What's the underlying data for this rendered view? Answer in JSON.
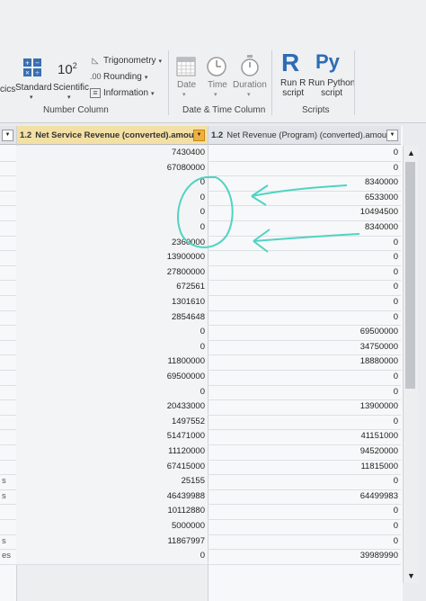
{
  "ribbon": {
    "cut_text": "cics",
    "standard": "Standard",
    "scientific": "Scientific",
    "scientific_base": "10",
    "scientific_exp": "2",
    "trigonometry": "Trigonometry",
    "rounding": "Rounding",
    "information": "Information",
    "date": "Date",
    "time": "Time",
    "duration": "Duration",
    "run_r_line1": "Run R",
    "run_r_line2": "script",
    "run_py_line1": "Run Python",
    "run_py_line2": "script",
    "r_logo": "R",
    "py_logo": "Py",
    "group_number_column": "Number Column",
    "group_date_time_column": "Date & Time Column",
    "group_scripts": "Scripts"
  },
  "grid": {
    "col1_type": "1.2",
    "col1_name": "Net Service Revenue (converted).amount",
    "col2_type": "1.2",
    "col2_name": "Net Revenue (Program) (converted).amount",
    "left_cells": [
      "",
      "",
      "",
      "",
      "",
      "",
      "",
      "",
      "",
      "",
      "",
      "",
      "",
      "",
      "",
      "",
      "",
      "",
      "",
      "",
      "",
      "",
      "s",
      "s",
      "",
      "",
      "s",
      "es"
    ],
    "col1": [
      "7430400",
      "67080000",
      "0",
      "0",
      "0",
      "0",
      "2360000",
      "13900000",
      "27800000",
      "672561",
      "1301610",
      "2854648",
      "0",
      "0",
      "11800000",
      "69500000",
      "0",
      "20433000",
      "1497552",
      "51471000",
      "11120000",
      "67415000",
      "25155",
      "46439988",
      "10112880",
      "5000000",
      "11867997",
      "0"
    ],
    "col2": [
      "0",
      "0",
      "8340000",
      "6533000",
      "10494500",
      "8340000",
      "0",
      "0",
      "0",
      "0",
      "0",
      "0",
      "69500000",
      "34750000",
      "18880000",
      "0",
      "0",
      "13900000",
      "0",
      "41151000",
      "94520000",
      "11815000",
      "0",
      "64499983",
      "0",
      "0",
      "0",
      "39989990"
    ]
  },
  "colors": {
    "highlight_header": "#f3e0a5",
    "annotation_stroke": "#4fd3c4"
  }
}
